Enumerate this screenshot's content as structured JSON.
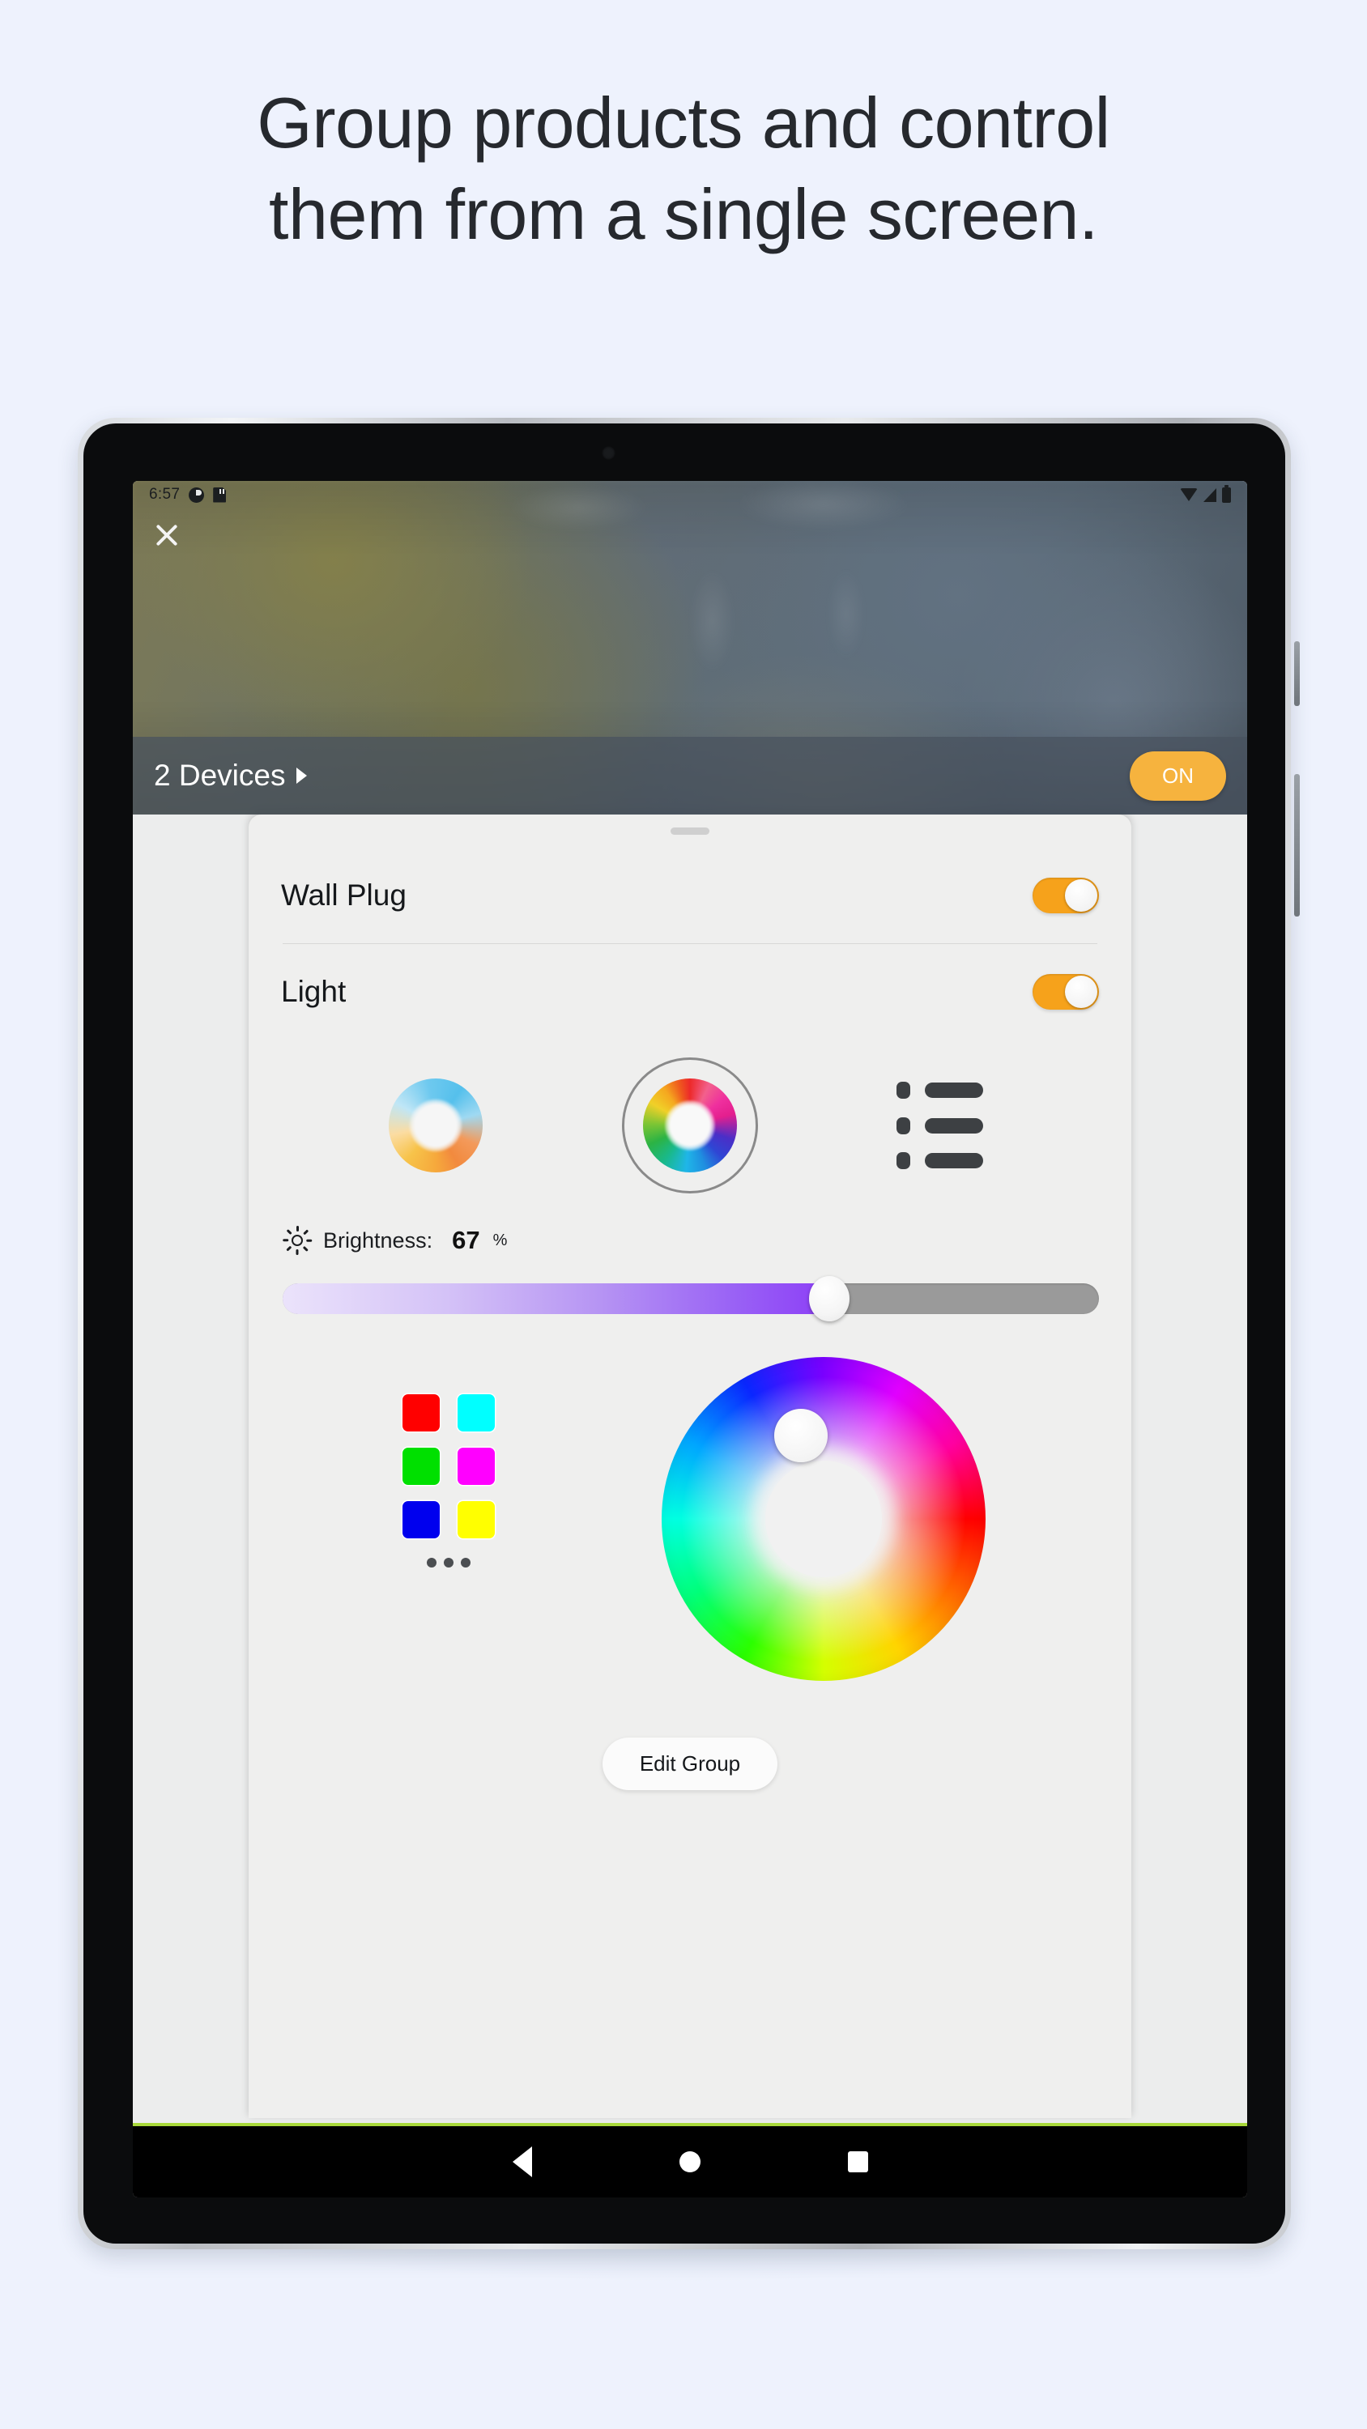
{
  "headline": {
    "line1": "Group products and control",
    "line2": "them from a single screen."
  },
  "status_bar": {
    "clock": "6:57",
    "left_icons": [
      "do-not-disturb-icon",
      "sd-card-icon"
    ],
    "right_icons": [
      "wifi-icon",
      "signal-icon",
      "battery-icon"
    ]
  },
  "photo_header": {
    "close_label": "close-icon",
    "devices_label": "2 Devices",
    "power_button_label": "ON"
  },
  "sheet": {
    "devices": [
      {
        "name": "Wall Plug",
        "toggle_state": "on"
      },
      {
        "name": "Light",
        "toggle_state": "on"
      }
    ],
    "modes": [
      {
        "name": "white-temperature-wheel",
        "selected": false
      },
      {
        "name": "color-wheel",
        "selected": true
      },
      {
        "name": "scenes-list",
        "selected": false
      }
    ],
    "brightness": {
      "icon": "sun-icon",
      "label": "Brightness:",
      "value": "67",
      "unit": "%",
      "percent": 67,
      "fill_start_color": "#ebe3fb",
      "fill_end_color": "#8c3ef7",
      "track_color": "#9a9a9a"
    },
    "swatches": [
      {
        "name": "red",
        "color": "#ff0000"
      },
      {
        "name": "cyan",
        "color": "#00ffff"
      },
      {
        "name": "green",
        "color": "#00e000"
      },
      {
        "name": "magenta",
        "color": "#ff00ff"
      },
      {
        "name": "blue",
        "color": "#0000ee"
      },
      {
        "name": "yellow",
        "color": "#ffff00"
      }
    ],
    "more_swatches_label": "...",
    "color_wheel": {
      "name": "hsv-color-wheel",
      "selector_position": "upper-left-violet"
    },
    "edit_group_label": "Edit Group"
  },
  "nav_bar": {
    "back": "back-icon",
    "home": "home-icon",
    "recents": "recents-icon"
  },
  "colors": {
    "page_background": "#eef2fd",
    "accent_orange": "#f6a21b",
    "pill_orange": "#f6b33e",
    "sheet_background": "#efefee",
    "nav_accent_green": "#a8d93a"
  }
}
